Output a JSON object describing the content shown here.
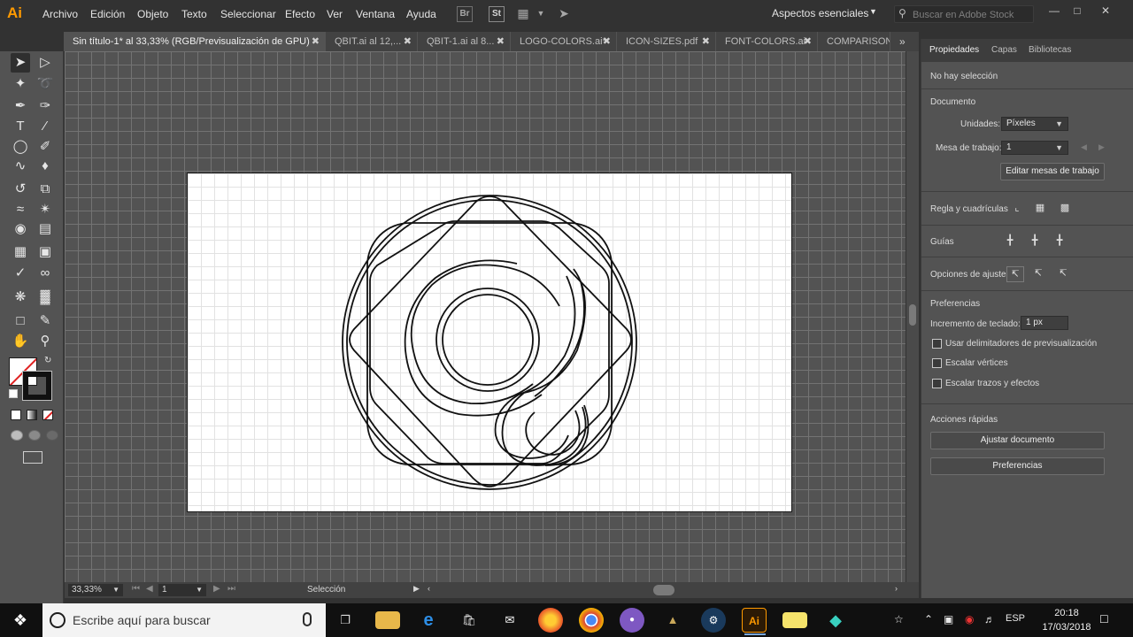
{
  "app": {
    "logo_text": "Ai",
    "menus": [
      "Archivo",
      "Edición",
      "Objeto",
      "Texto",
      "Seleccionar",
      "Efecto",
      "Ver",
      "Ventana",
      "Ayuda"
    ],
    "bridge_label": "Br",
    "stock_label": "St",
    "workspace": "Aspectos esenciales",
    "stock_search_placeholder": "Buscar en Adobe Stock"
  },
  "tabs": [
    {
      "label": "Sin título-1* al 33,33% (RGB/Previsualización de GPU)",
      "active": true
    },
    {
      "label": "QBIT.ai al 12,...",
      "active": false
    },
    {
      "label": "QBIT-1.ai al 8...",
      "active": false
    },
    {
      "label": "LOGO-COLORS.ai*",
      "active": false
    },
    {
      "label": "ICON-SIZES.pdf",
      "active": false
    },
    {
      "label": "FONT-COLORS.ai",
      "active": false
    },
    {
      "label": "COMPARISON",
      "active": false
    }
  ],
  "status": {
    "zoom": "33,33%",
    "artboard_number": "1",
    "tool_name": "Selección"
  },
  "panel": {
    "tabs": [
      "Propiedades",
      "Capas",
      "Bibliotecas"
    ],
    "no_selection": "No hay selección",
    "document_heading": "Documento",
    "units_label": "Unidades:",
    "units_value": "Píxeles",
    "artboard_label": "Mesa de trabajo:",
    "artboard_value": "1",
    "edit_artboards_button": "Editar mesas de trabajo",
    "rulers_grid_label": "Regla y cuadrículas",
    "guides_label": "Guías",
    "snap_options_label": "Opciones de ajuste",
    "preferences_heading": "Preferencias",
    "keyboard_increment_label": "Incremento de teclado:",
    "keyboard_increment_value": "1 px",
    "checkboxes": [
      {
        "label": "Usar delimitadores de previsualización",
        "checked": false
      },
      {
        "label": "Escalar vértices",
        "checked": false
      },
      {
        "label": "Escalar trazos y efectos",
        "checked": false
      }
    ],
    "quick_actions_heading": "Acciones rápidas",
    "fit_document_button": "Ajustar documento",
    "preferences_button": "Preferencias"
  },
  "taskbar": {
    "search_placeholder": "Escribe aquí para buscar",
    "language": "ESP",
    "time": "20:18",
    "date": "17/03/2018"
  },
  "colors": {
    "ai_orange": "#ff9a00",
    "canvas_bg": "#535353",
    "artboard_bg": "#ffffff"
  }
}
